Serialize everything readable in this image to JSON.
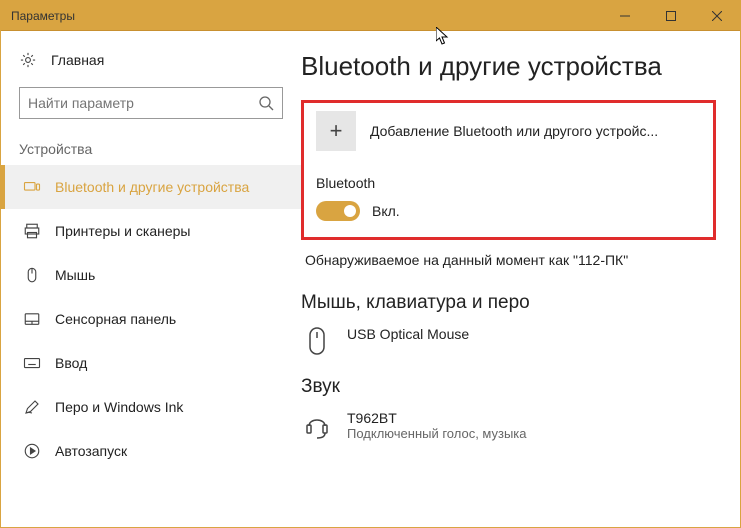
{
  "window": {
    "title": "Параметры"
  },
  "home": {
    "label": "Главная"
  },
  "search": {
    "placeholder": "Найти параметр"
  },
  "section_label": "Устройства",
  "nav": {
    "items": [
      {
        "label": "Bluetooth и другие устройства"
      },
      {
        "label": "Принтеры и сканеры"
      },
      {
        "label": "Мышь"
      },
      {
        "label": "Сенсорная панель"
      },
      {
        "label": "Ввод"
      },
      {
        "label": "Перо и Windows Ink"
      },
      {
        "label": "Автозапуск"
      }
    ]
  },
  "page": {
    "title": "Bluetooth и другие устройства",
    "add_device": "Добавление Bluetooth или другого устройс...",
    "bt_heading": "Bluetooth",
    "bt_toggle_label": "Вкл.",
    "discoverable": "Обнаруживаемое на данный момент как \"112-ПК\"",
    "group_mouse": "Мышь, клавиатура и перо",
    "device_mouse": "USB Optical Mouse",
    "group_audio": "Звук",
    "device_audio_name": "T962BT",
    "device_audio_status": "Подключенный голос, музыка"
  }
}
